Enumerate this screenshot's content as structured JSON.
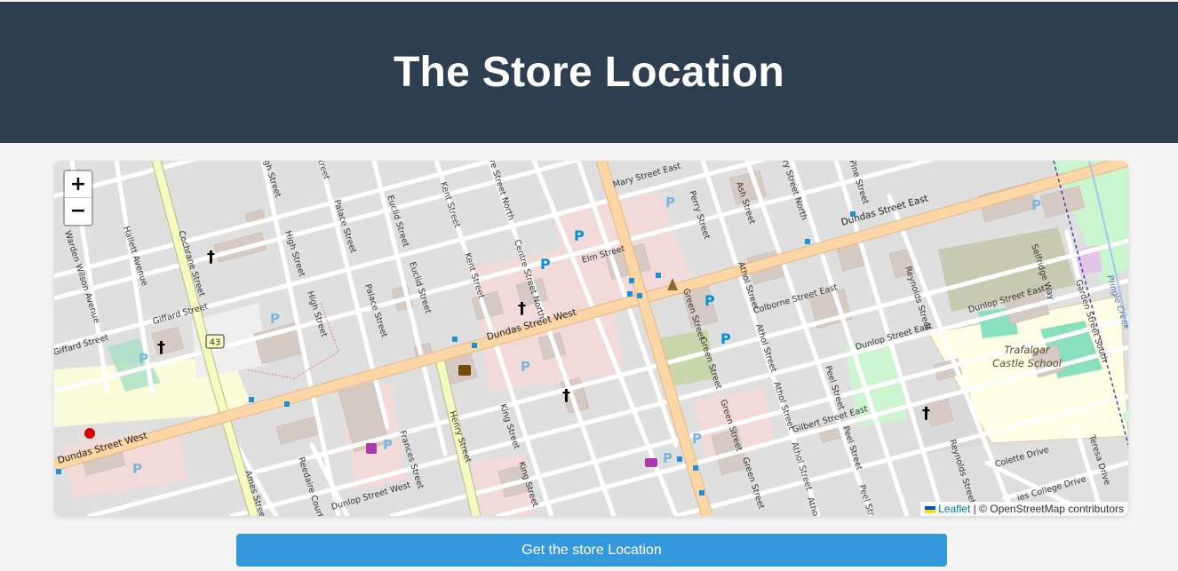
{
  "header": {
    "title": "The Store Location"
  },
  "map": {
    "zoom_in_label": "+",
    "zoom_out_label": "−",
    "attribution": {
      "leaflet_label": "Leaflet",
      "separator": " | ",
      "osm_label": "© OpenStreetMap contributors"
    },
    "route_shield": "43",
    "school_name_line1": "Trafalgar",
    "school_name_line2": "Castle School",
    "streets": {
      "dundas_west": "Dundas Street West",
      "dundas_west_2": "Dundas Street West",
      "dundas_east": "Dundas Street East",
      "cochrane": "Cochrane Street",
      "henry": "Henry Street",
      "green": "Green Street",
      "green_2": "Green Street",
      "green_3": "Green Street",
      "green_4": "Green Street",
      "king": "King Street",
      "king_2": "King Street",
      "frances": "Frances Street",
      "reedaire": "Reedaire Court",
      "ames": "Ames Street",
      "dunlop_west": "Dunlop Street West",
      "dunlop_east": "Dunlop Street East",
      "dunlop_east_2": "Dunlop Street East",
      "colborne_east": "Colborne Street East",
      "gilbert_east": "Gilbert Street East",
      "giffard": "Giffard Street",
      "giffard_2": "Giffard Street",
      "warden_wilson": "Warden Wilson Avenue",
      "hallett": "Hallett Avenue",
      "high": "High Street",
      "high_2": "High Street",
      "high_3": "gh Street",
      "palace": "Palace Street",
      "palace_2": "Palace Street",
      "euclid": "Euclid Street",
      "euclid_2": "Euclid Street",
      "kent": "Kent Street",
      "kent_2": "Kent Street",
      "centre_north": "Centre Street North",
      "centre_north_2": "re Street North",
      "elm": "Elm Street",
      "mary_east": "Mary Street East",
      "perry": "Perry Street",
      "ash": "Ash Street",
      "athol": "Athol Street",
      "athol_2": "Athol Street",
      "athol_3": "Athol Street",
      "athol_4": "Athol Street",
      "peel": "Peel Street",
      "peel_2": "Peel Street",
      "peel_3": "Peel Street",
      "byron_north": "ry Street North",
      "pine": "Pine Street",
      "reynolds": "Reynolds Street",
      "reynolds_2": "Reynolds Street",
      "selfridge": "Selfridge Way",
      "garden_south": "Garden Street South",
      "colette": "Colette Drive",
      "teresa": "Teresa Drive",
      "college": "ies College Drive",
      "pringle": "Pringle Creek",
      "street_top": "treet",
      "athol_cut": "Atho"
    }
  },
  "button": {
    "label": "Get the store Location"
  },
  "colors": {
    "header_bg": "#2c3e50",
    "page_bg": "#f4f4f4",
    "button_bg": "#3498db",
    "primary_road": "#fcd6a4",
    "secondary_road": "#f7fabf",
    "commercial": "#f2dad9",
    "school": "#ffffe5"
  }
}
